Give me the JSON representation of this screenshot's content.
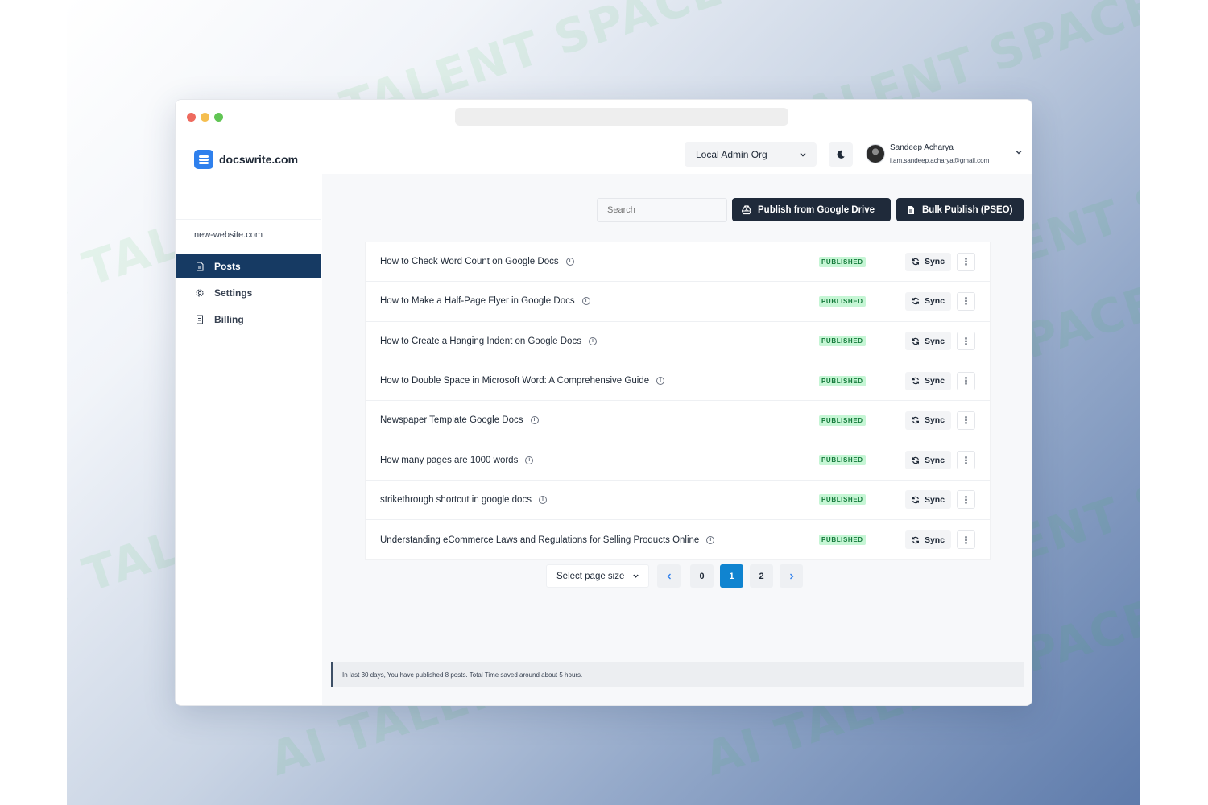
{
  "brand": {
    "name": "docswrite.com",
    "color": "#2f80ed"
  },
  "site": {
    "name": "new-website.com"
  },
  "sidebar": {
    "items": [
      {
        "label": "Posts",
        "icon": "document-icon",
        "active": true
      },
      {
        "label": "Settings",
        "icon": "gear-icon",
        "active": false
      },
      {
        "label": "Billing",
        "icon": "receipt-icon",
        "active": false
      }
    ]
  },
  "header": {
    "org_select": "Local Admin Org",
    "theme_toggle_icon": "moon-icon",
    "user": {
      "name": "Sandeep Acharya",
      "email": "i.am.sandeep.acharya@gmail.com"
    }
  },
  "toolbar": {
    "search_placeholder": "Search",
    "publish_drive_label": "Publish from Google Drive",
    "bulk_publish_label": "Bulk Publish (PSEO)"
  },
  "posts": [
    {
      "title": "How to Check Word Count on Google Docs",
      "status": "PUBLISHED",
      "sync_label": "Sync"
    },
    {
      "title": "How to Make a Half-Page Flyer in Google Docs",
      "status": "PUBLISHED",
      "sync_label": "Sync"
    },
    {
      "title": "How to Create a Hanging Indent on Google Docs",
      "status": "PUBLISHED",
      "sync_label": "Sync"
    },
    {
      "title": "How to Double Space in Microsoft Word: A Comprehensive Guide",
      "status": "PUBLISHED",
      "sync_label": "Sync"
    },
    {
      "title": "Newspaper Template Google Docs",
      "status": "PUBLISHED",
      "sync_label": "Sync"
    },
    {
      "title": "How many pages are 1000 words",
      "status": "PUBLISHED",
      "sync_label": "Sync"
    },
    {
      "title": "strikethrough shortcut in google docs",
      "status": "PUBLISHED",
      "sync_label": "Sync"
    },
    {
      "title": "Understanding eCommerce Laws and Regulations for Selling Products Online",
      "status": "PUBLISHED",
      "sync_label": "Sync"
    }
  ],
  "pagination": {
    "page_size_label": "Select page size",
    "pages": [
      "0",
      "1",
      "2"
    ],
    "current_page": "1"
  },
  "notice": "In last 30 days, You have published 8 posts. Total Time saved around about 5 hours.",
  "watermark": "AI TALENT SPACE",
  "colors": {
    "sidebar_active": "#163a63",
    "primary_button": "#1f2a3a",
    "badge_bg": "#c6f6d5",
    "badge_text": "#137a3a",
    "page_active": "#1084d0",
    "chat_button": "#1a73e8"
  }
}
